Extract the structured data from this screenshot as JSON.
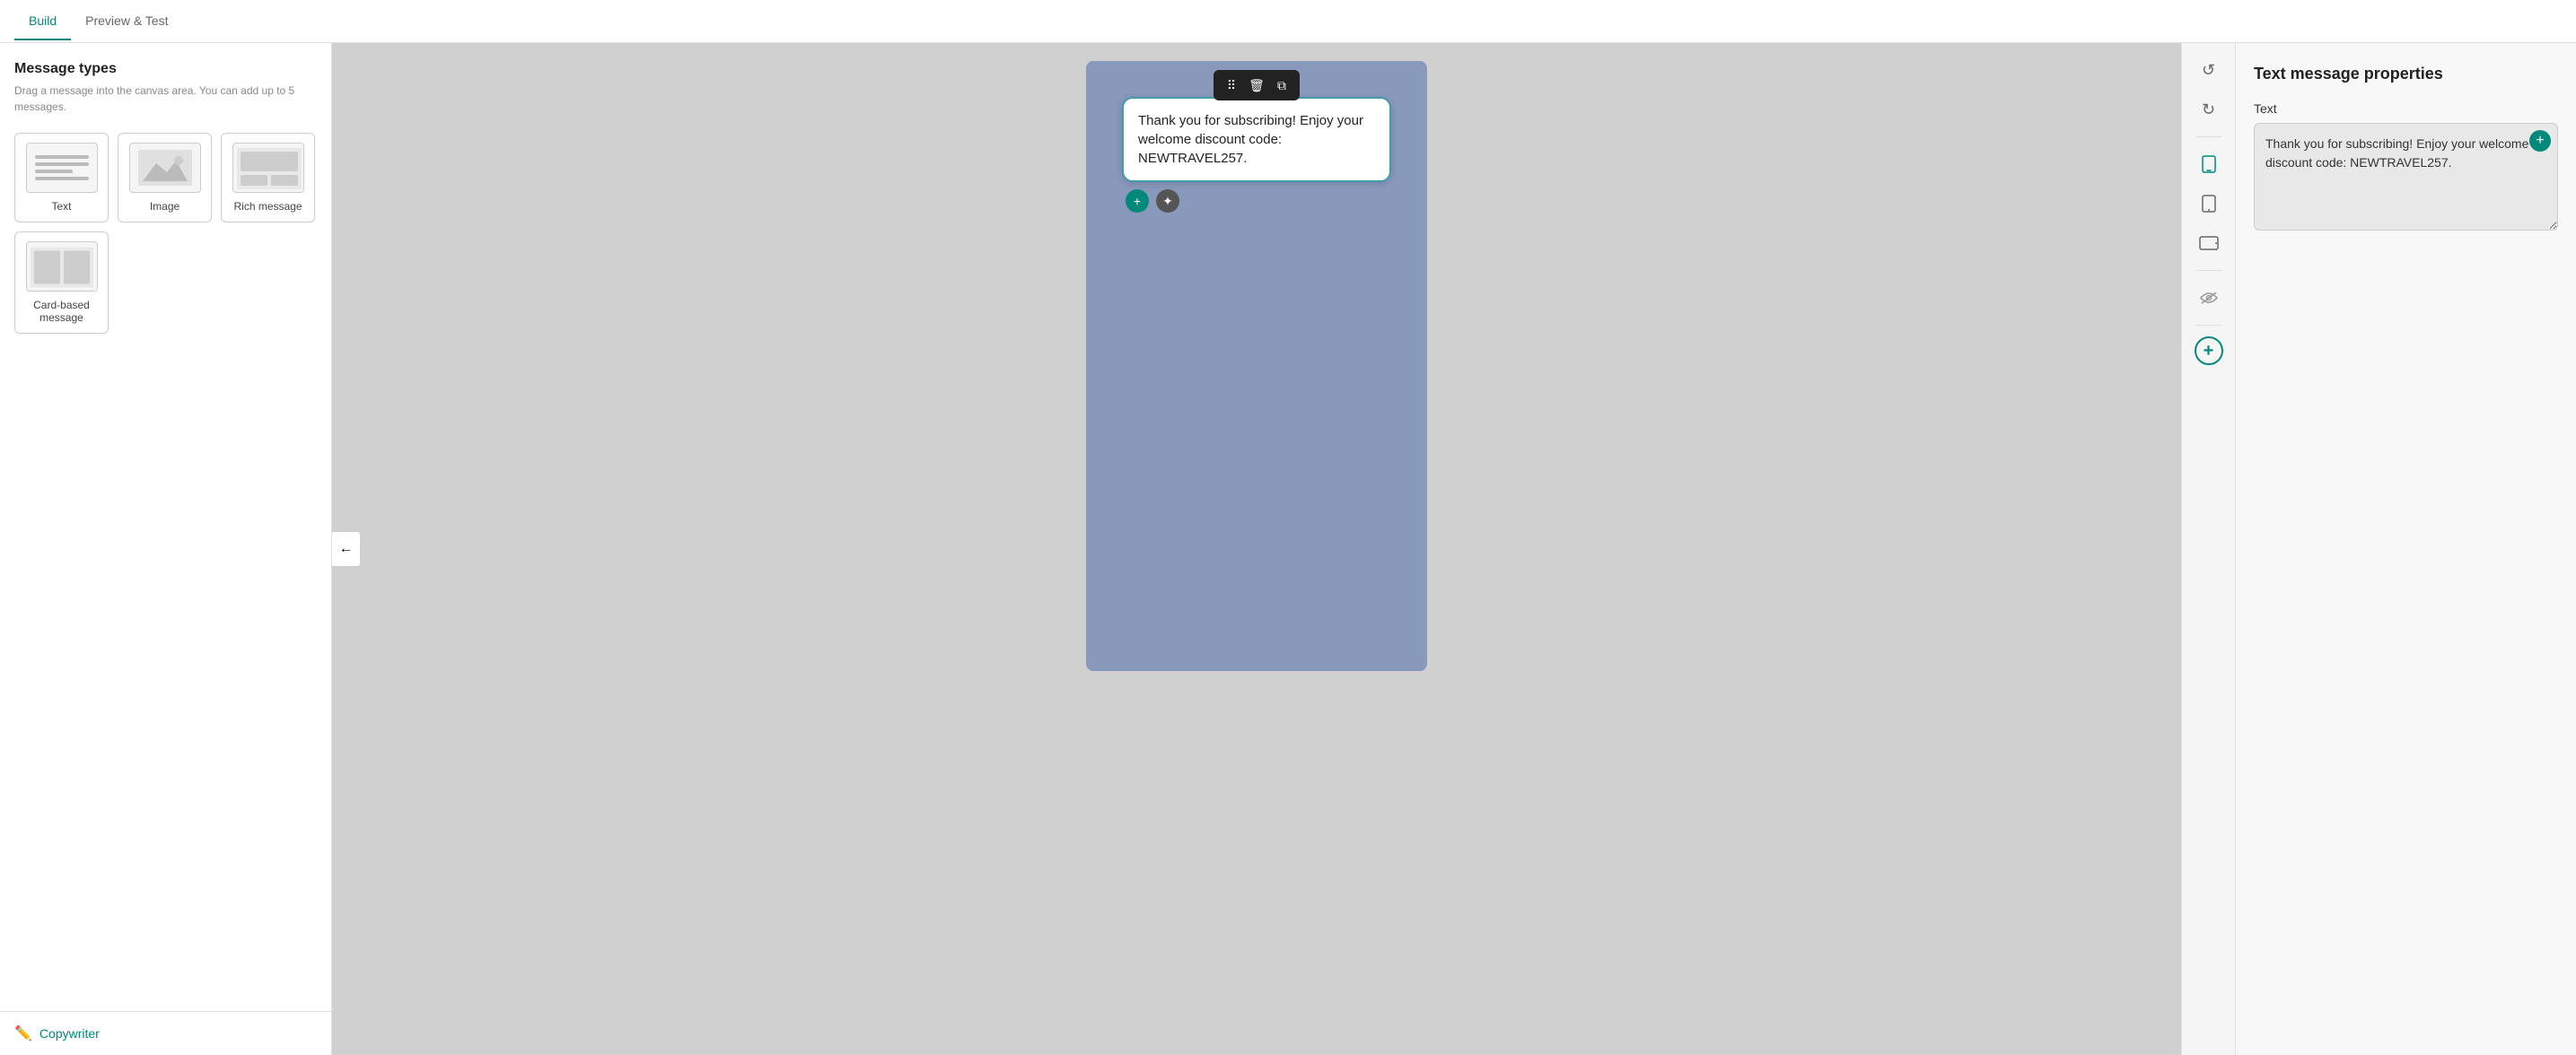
{
  "tabs": [
    {
      "id": "build",
      "label": "Build",
      "active": true
    },
    {
      "id": "preview",
      "label": "Preview & Test",
      "active": false
    }
  ],
  "sidebar": {
    "title": "Message types",
    "description": "Drag a message into the canvas area. You can add up to 5 messages.",
    "message_types": [
      {
        "id": "text",
        "label": "Text"
      },
      {
        "id": "image",
        "label": "Image"
      },
      {
        "id": "rich",
        "label": "Rich message"
      },
      {
        "id": "card",
        "label": "Card-based message"
      }
    ],
    "copywriter_label": "Copywriter"
  },
  "canvas": {
    "bubble_text": "Thank you for subscribing! Enjoy your welcome discount code: NEWTRAVEL257.",
    "collapse_icon": "←"
  },
  "right_toolbar": {
    "undo_label": "↺",
    "redo_label": "↻",
    "mobile_icon": "📱",
    "tablet_portrait_icon": "▭",
    "tablet_landscape_icon": "▬",
    "hide_icon": "👁",
    "add_icon": "+"
  },
  "properties_panel": {
    "title": "Text message properties",
    "text_label": "Text",
    "text_value": "Thank you for subscribing! Enjoy your welcome discount code: NEWTRAVEL257."
  }
}
